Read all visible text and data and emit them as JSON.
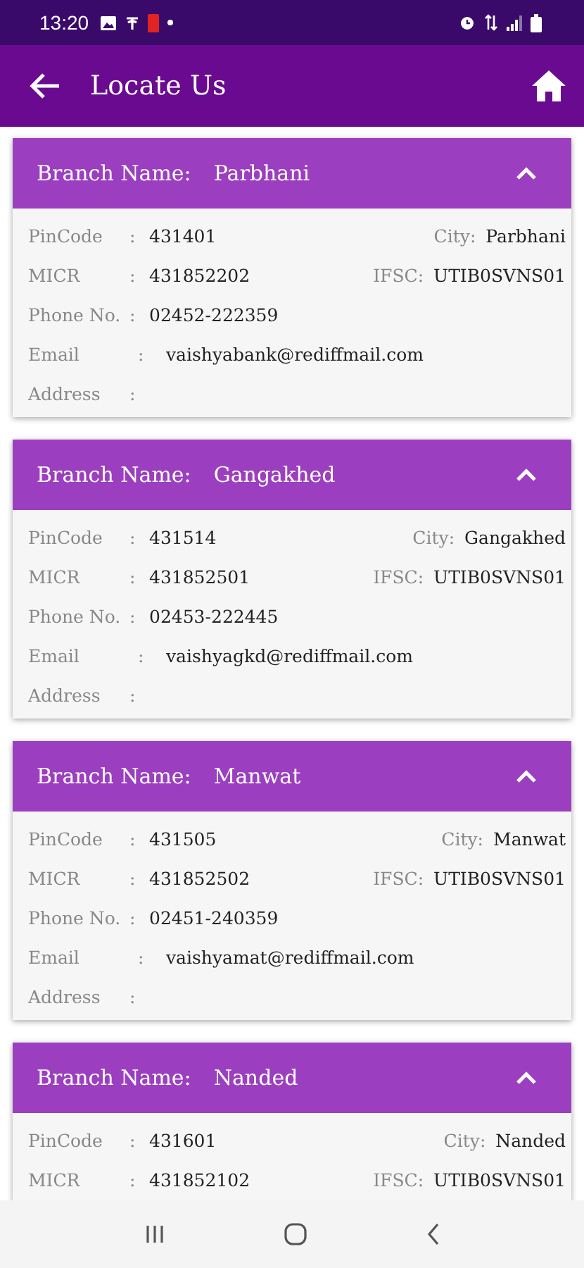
{
  "status_bar": {
    "time": "13:20"
  },
  "app_bar": {
    "title": "Locate Us"
  },
  "branches": [
    {
      "label": "Branch Name:",
      "name": "Parbhani",
      "expanded": true,
      "rows": [
        {
          "label": "PinCode",
          "separator": ":",
          "value": "431401",
          "right_label": "City:",
          "right_value": "Parbhani"
        },
        {
          "label": "MICR",
          "separator": ":",
          "value": "431852202",
          "right_label": "IFSC:",
          "right_value": "UTIB0SVNS01"
        },
        {
          "label": "Phone No.",
          "separator": ":",
          "value": "02452-222359"
        },
        {
          "label": "Email",
          "separator": ":",
          "value": "vaishyabank@rediffmail.com"
        },
        {
          "label": "Address",
          "separator": ":"
        }
      ]
    },
    {
      "label": "Branch Name:",
      "name": "Gangakhed",
      "expanded": true,
      "rows": [
        {
          "label": "PinCode",
          "separator": ":",
          "value": "431514",
          "right_label": "City:",
          "right_value": "Gangakhed"
        },
        {
          "label": "MICR",
          "separator": ":",
          "value": "431852501",
          "right_label": "IFSC:",
          "right_value": "UTIB0SVNS01"
        },
        {
          "label": "Phone No.",
          "separator": ":",
          "value": "02453-222445"
        },
        {
          "label": "Email",
          "separator": ":",
          "value": "vaishyagkd@rediffmail.com"
        },
        {
          "label": "Address",
          "separator": ":"
        }
      ]
    },
    {
      "label": "Branch Name:",
      "name": "Manwat",
      "expanded": true,
      "rows": [
        {
          "label": "PinCode",
          "separator": ":",
          "value": "431505",
          "right_label": "City:",
          "right_value": "Manwat"
        },
        {
          "label": "MICR",
          "separator": ":",
          "value": "431852502",
          "right_label": "IFSC:",
          "right_value": "UTIB0SVNS01"
        },
        {
          "label": "Phone No.",
          "separator": ":",
          "value": "02451-240359"
        },
        {
          "label": "Email",
          "separator": ":",
          "value": "vaishyamat@rediffmail.com"
        },
        {
          "label": "Address",
          "separator": ":"
        }
      ]
    },
    {
      "label": "Branch Name:",
      "name": "Nanded",
      "expanded": true,
      "rows": [
        {
          "label": "PinCode",
          "separator": ":",
          "value": "431601",
          "right_label": "City:",
          "right_value": "Nanded"
        },
        {
          "label": "MICR",
          "separator": ":",
          "value": "431852102",
          "right_label": "IFSC:",
          "right_value": "UTIB0SVNS01"
        }
      ]
    }
  ]
}
